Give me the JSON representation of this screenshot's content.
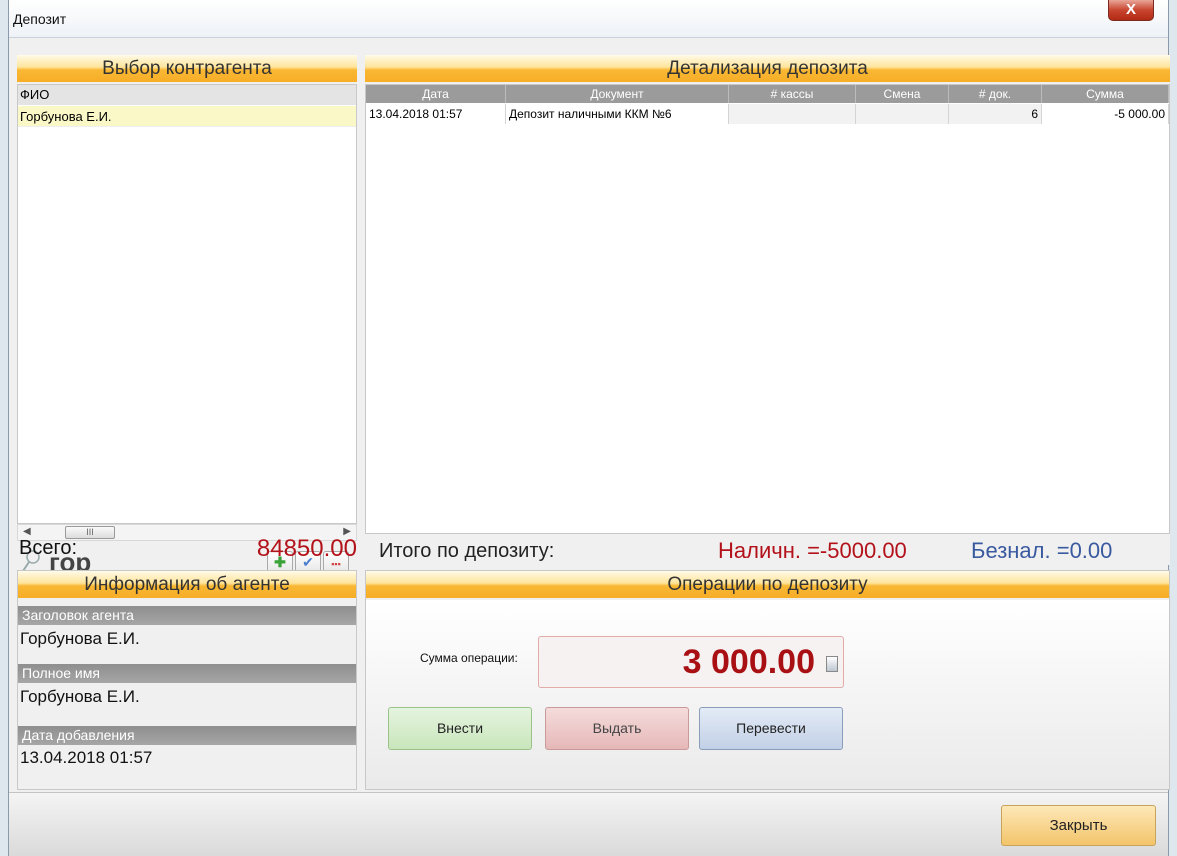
{
  "window": {
    "title": "Депозит",
    "close_glyph": "X"
  },
  "left_panel": {
    "header": "Выбор контрагента",
    "column_header": "ФИО",
    "rows": [
      "Горбунова Е.И."
    ],
    "scroll_thumb": "III",
    "search_text": "гор",
    "total_label": "Всего:",
    "total_value": "84850.00"
  },
  "detail_panel": {
    "header": "Детализация депозита",
    "columns": [
      "Дата",
      "Документ",
      "# кассы",
      "Смена",
      "# док.",
      "Сумма"
    ],
    "rows": [
      {
        "date": "13.04.2018 01:57",
        "document": "Депозит наличными ККМ №6",
        "register": "",
        "shift": "",
        "doc_no": "6",
        "sum": "-5 000.00"
      }
    ],
    "summary_label": "Итого по депозиту:",
    "cash_total": "Наличн. =-5000.00",
    "cashless_total": "Безнал. =0.00"
  },
  "agent_panel": {
    "header": "Информация об агенте",
    "fields": [
      {
        "label": "Заголовок агента",
        "value": "Горбунова Е.И."
      },
      {
        "label": "Полное имя",
        "value": "Горбунова Е.И."
      },
      {
        "label": "Дата добавления",
        "value": "13.04.2018 01:57"
      }
    ]
  },
  "ops_panel": {
    "header": "Операции по депозиту",
    "amount_label": "Сумма операции:",
    "amount_value": "3 000.00",
    "buttons": {
      "deposit": "Внести",
      "withdraw": "Выдать",
      "transfer": "Перевести"
    }
  },
  "footer": {
    "close_label": "Закрыть"
  },
  "colors": {
    "accent_orange": "#f7ad28",
    "negative_red": "#b3121a",
    "cashless_blue": "#3a5aa0"
  },
  "icons": [
    "search-icon",
    "add-icon",
    "check-icon",
    "more-icon",
    "calculator-icon",
    "close-icon"
  ]
}
